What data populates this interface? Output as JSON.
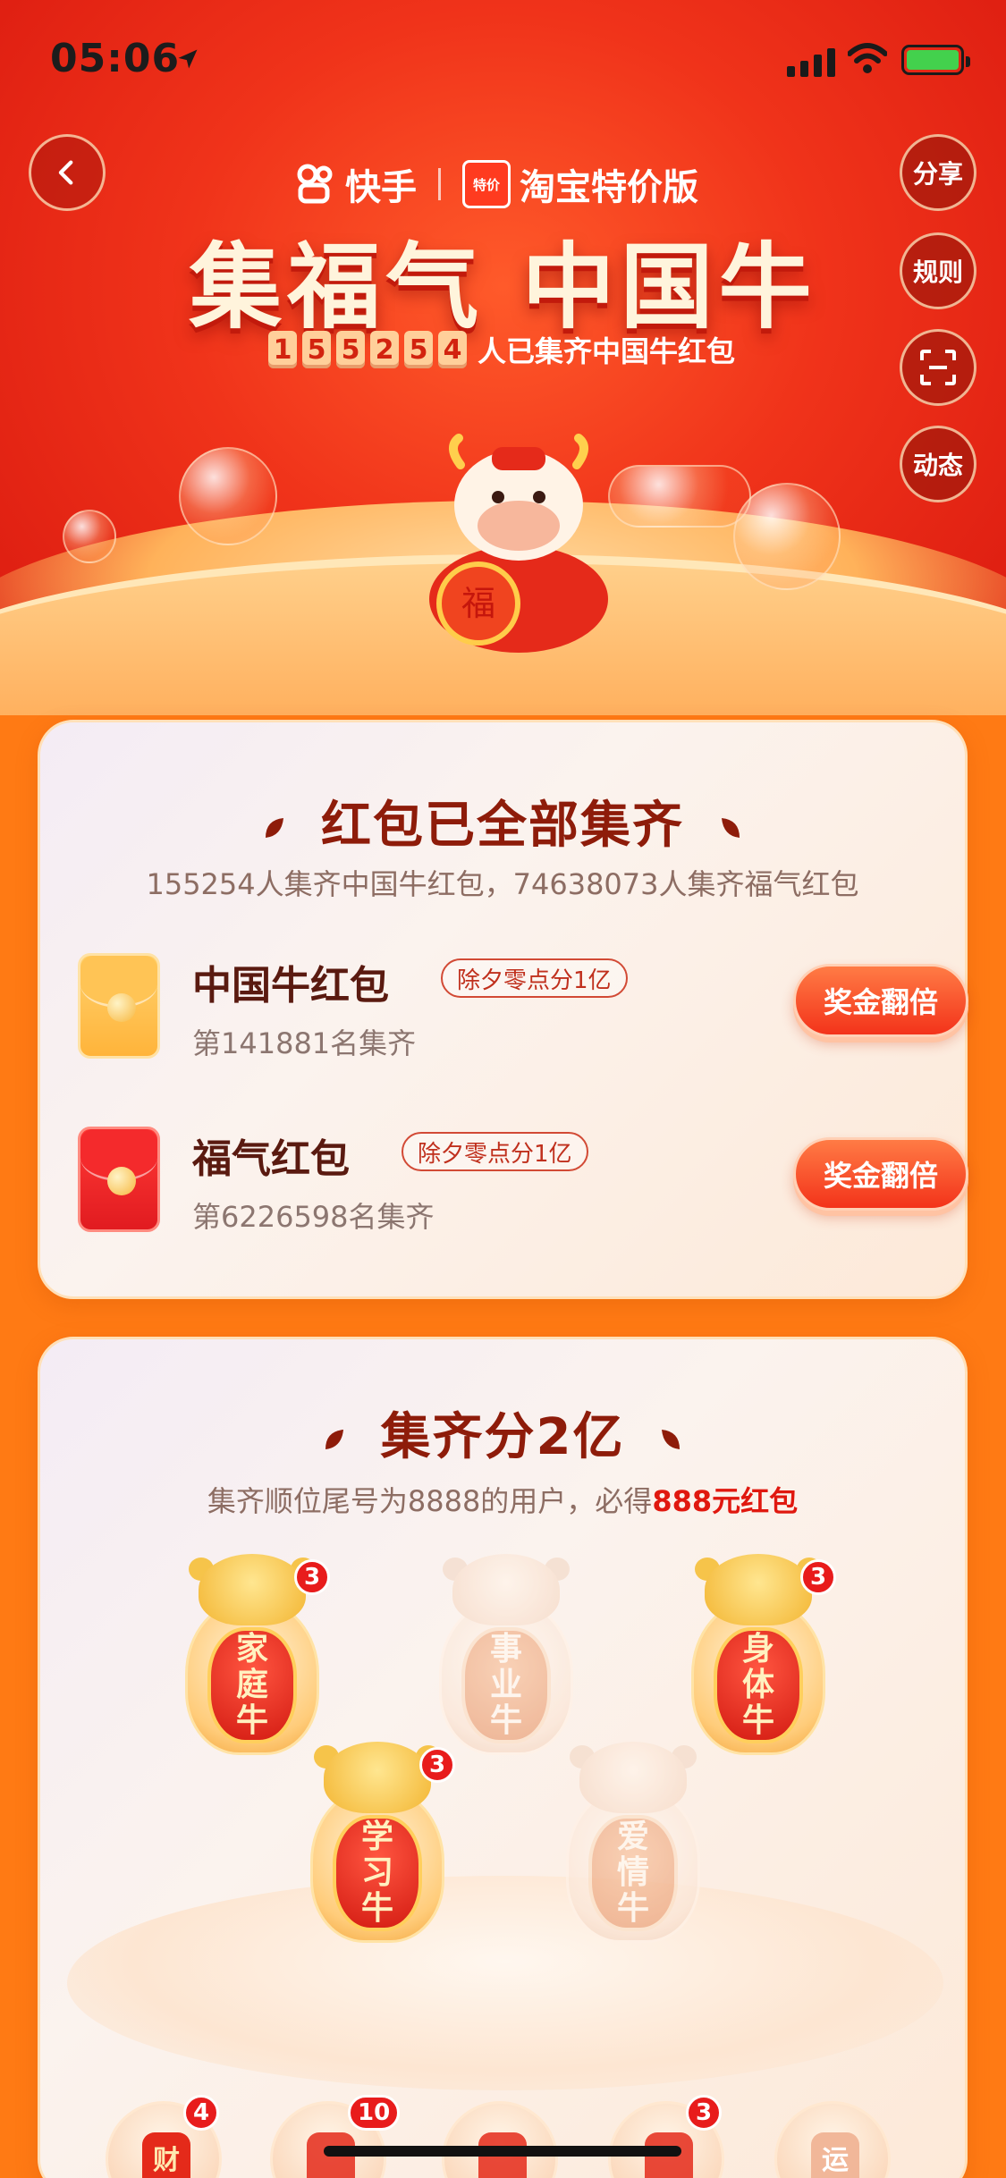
{
  "status": {
    "time": "05:06"
  },
  "header": {
    "brand_kuaishou": "快手",
    "brand_taobao_badge": "特价",
    "brand_taobao": "淘宝特价版",
    "title": "集福气 中国牛",
    "counter_digits": [
      "1",
      "5",
      "5",
      "2",
      "5",
      "4"
    ],
    "counter_text": "人已集齐中国牛红包",
    "side_buttons": {
      "share": "分享",
      "rules": "规则",
      "dynamic": "动态"
    }
  },
  "card1": {
    "title": "红包已全部集齐",
    "subtitle": "155254人集齐中国牛红包，74638073人集齐福气红包",
    "rows": [
      {
        "name": "中国牛红包",
        "tag": "除夕零点分1亿",
        "rank": "第141881名集齐",
        "button": "奖金翻倍"
      },
      {
        "name": "福气红包",
        "tag": "除夕零点分1亿",
        "rank": "第6226598名集齐",
        "button": "奖金翻倍"
      }
    ]
  },
  "card2": {
    "title": "集齐分2亿",
    "subtitle_prefix": "集齐顺位尾号为8888的用户，必得",
    "subtitle_highlight": "888元红包",
    "cattle": [
      {
        "name": [
          "家",
          "庭",
          "牛"
        ],
        "count": "3",
        "state": "active"
      },
      {
        "name": [
          "事",
          "业",
          "牛"
        ],
        "count": "",
        "state": "inactive"
      },
      {
        "name": [
          "身",
          "体",
          "牛"
        ],
        "count": "3",
        "state": "active"
      },
      {
        "name": [
          "学",
          "习",
          "牛"
        ],
        "count": "3",
        "state": "active"
      },
      {
        "name": [
          "爱",
          "情",
          "牛"
        ],
        "count": "",
        "state": "inactive"
      }
    ]
  },
  "bottom_row": [
    {
      "label": "财",
      "count": "4"
    },
    {
      "label": "",
      "count": "10"
    },
    {
      "label": "",
      "count": ""
    },
    {
      "label": "",
      "count": "3"
    },
    {
      "label": "运",
      "count": ""
    }
  ],
  "colors": {
    "primary_red": "#e81c1c",
    "title_brown": "#8e1c0a",
    "accent_orange": "#ff7a14"
  }
}
